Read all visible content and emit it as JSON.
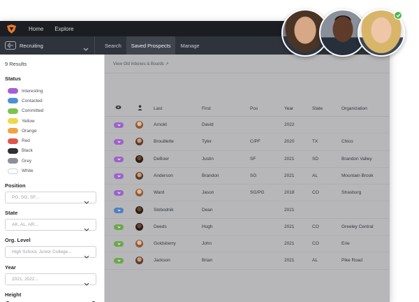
{
  "nav": {
    "links": [
      "Home",
      "Explore"
    ]
  },
  "workspace": {
    "label": "Recruiting"
  },
  "tabs": [
    "Search",
    "Saved Prospects",
    "Manage"
  ],
  "sidebar": {
    "results": "9 Results",
    "status_title": "Status",
    "statuses": [
      {
        "label": "Interesting",
        "color": "#a55ed6"
      },
      {
        "label": "Contacted",
        "color": "#4d8fd6"
      },
      {
        "label": "Committed",
        "color": "#7dc24e"
      },
      {
        "label": "Yellow",
        "color": "#f0d748"
      },
      {
        "label": "Orange",
        "color": "#f0a440"
      },
      {
        "label": "Red",
        "color": "#e2544c"
      },
      {
        "label": "Black",
        "color": "#2e3035"
      },
      {
        "label": "Grey",
        "color": "#8d9097"
      },
      {
        "label": "White",
        "color": "#ffffff"
      }
    ],
    "filters": {
      "position": {
        "title": "Position",
        "placeholder": "PG, SG, SF..."
      },
      "state": {
        "title": "State",
        "placeholder": "AK, AL, AR..."
      },
      "org_level": {
        "title": "Org. Level",
        "placeholder": "High School, Junior College..."
      },
      "year": {
        "title": "Year",
        "placeholder": "2021, 2022..."
      },
      "height": {
        "title": "Height"
      }
    }
  },
  "content": {
    "old_link": "View Old Inboxes & Boards ↗",
    "columns": [
      "Last",
      "First",
      "Pos",
      "Year",
      "State",
      "Organization"
    ],
    "rows": [
      {
        "tag": "#9d63c9",
        "last": "Arnold",
        "first": "David",
        "pos": "",
        "year": "2022",
        "state": "",
        "org": ""
      },
      {
        "tag": "#9d63c9",
        "last": "Brouillette",
        "first": "Tyler",
        "pos": "C/PF",
        "year": "2020",
        "state": "TX",
        "org": "Chico"
      },
      {
        "tag": "#9d63c9",
        "last": "DeBoer",
        "first": "Justin",
        "pos": "SF",
        "year": "2021",
        "state": "SD",
        "org": "Brandon Valley"
      },
      {
        "tag": "#9d63c9",
        "last": "Anderson",
        "first": "Brandon",
        "pos": "SG",
        "year": "2021",
        "state": "AL",
        "org": "Mountain Brook"
      },
      {
        "tag": "#9d63c9",
        "last": "Ward",
        "first": "Jason",
        "pos": "SG/PG",
        "year": "2018",
        "state": "CO",
        "org": "Strasburg"
      },
      {
        "tag": "#4f80c0",
        "last": "Slobodnik",
        "first": "Dean",
        "pos": "",
        "year": "2021",
        "state": "",
        "org": ""
      },
      {
        "tag": "#6aa84b",
        "last": "Deeds",
        "first": "Hugh",
        "pos": "",
        "year": "2021",
        "state": "CO",
        "org": "Greeley Central"
      },
      {
        "tag": "#6aa84b",
        "last": "Goldsberry",
        "first": "John",
        "pos": "",
        "year": "2021",
        "state": "CO",
        "org": "Erie"
      },
      {
        "tag": "#6aa84b",
        "last": "Jackson",
        "first": "Brian",
        "pos": "",
        "year": "2021",
        "state": "AL",
        "org": "Pike Road"
      }
    ]
  }
}
